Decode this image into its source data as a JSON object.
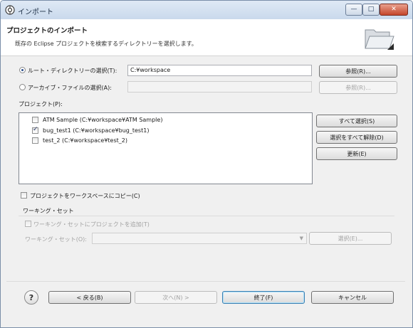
{
  "window": {
    "title": "インポート",
    "minimize_glyph": "—",
    "maximize_glyph": "□",
    "close_glyph": "✕"
  },
  "banner": {
    "title": "プロジェクトのインポート",
    "description": "既存の Eclipse プロジェクトを検索するディレクトリーを選択します。",
    "icon": "open-folder-icon"
  },
  "root_dir": {
    "label": "ルート・ディレクトリーの選択(T):",
    "value": "C:¥workspace",
    "selected": true,
    "browse_label": "参照(R)..."
  },
  "archive": {
    "label": "アーカイブ・ファイルの選択(A):",
    "value": "",
    "selected": false,
    "browse_label": "参照(R)..."
  },
  "projects": {
    "label": "プロジェクト(P):",
    "items": [
      {
        "label": "ATM Sample (C:¥workspace¥ATM Sample)",
        "checked": false
      },
      {
        "label": "bug_test1 (C:¥workspace¥bug_test1)",
        "checked": true
      },
      {
        "label": "test_2 (C:¥workspace¥test_2)",
        "checked": false
      }
    ],
    "select_all_label": "すべて選択(S)",
    "deselect_all_label": "選択をすべて解除(D)",
    "refresh_label": "更新(E)"
  },
  "copy_into_workspace": {
    "label": "プロジェクトをワークスペースにコピー(C)",
    "checked": false
  },
  "working_set": {
    "group_label": "ワーキング・セット",
    "add_label": "ワーキング・セットにプロジェクトを追加(T)",
    "add_checked": false,
    "sets_label": "ワーキング・セット(O):",
    "sets_value": "",
    "select_label": "選択(E)..."
  },
  "footer": {
    "help_glyph": "?",
    "back_label": "< 戻る(B)",
    "next_label": "次へ(N) >",
    "finish_label": "終了(F)",
    "cancel_label": "キャンセル"
  },
  "colors": {
    "title_bar": "#c9d9ec",
    "close_button": "#c4462b",
    "radio_selected": "#2a4f8f",
    "default_button_border": "#3c7fb1"
  }
}
